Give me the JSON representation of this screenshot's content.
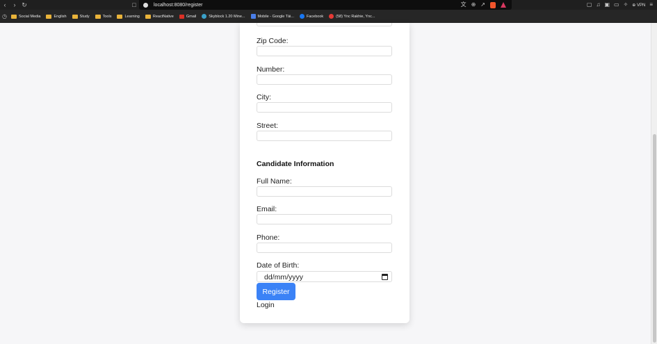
{
  "browser": {
    "url": "localhost:8080/register",
    "vpn_label": "VPN",
    "bookmarks": [
      {
        "label": "Social Media",
        "kind": "folder"
      },
      {
        "label": "English",
        "kind": "folder"
      },
      {
        "label": "Study",
        "kind": "folder"
      },
      {
        "label": "Tools",
        "kind": "folder"
      },
      {
        "label": "Learning",
        "kind": "folder"
      },
      {
        "label": "ReactNative",
        "kind": "folder"
      },
      {
        "label": "Gmail",
        "kind": "gmail-icon"
      },
      {
        "label": "Skyblock 1.20 Mine...",
        "kind": "globe-icon"
      },
      {
        "label": "Mobile - Google Tài...",
        "kind": "sheets-icon"
      },
      {
        "label": "Facebook",
        "kind": "facebook-icon"
      },
      {
        "label": "(58) Ync Rakhie, Ync...",
        "kind": "youtube-icon"
      }
    ]
  },
  "form": {
    "address_fields": [
      {
        "label": "Zip Code:",
        "value": ""
      },
      {
        "label": "Number:",
        "value": ""
      },
      {
        "label": "City:",
        "value": ""
      },
      {
        "label": "Street:",
        "value": ""
      }
    ],
    "candidate_section_title": "Candidate Information",
    "candidate_fields": [
      {
        "label": "Full Name:",
        "value": ""
      },
      {
        "label": "Email:",
        "value": ""
      },
      {
        "label": "Phone:",
        "value": ""
      }
    ],
    "dob_label": "Date of Birth:",
    "dob_placeholder": "dd/mm/yyyy",
    "register_label": "Register",
    "login_label": "Login"
  },
  "colors": {
    "primary_button": "#3b82f6",
    "page_background": "#f6f6f8",
    "chrome_dark": "#1f1f1f"
  }
}
